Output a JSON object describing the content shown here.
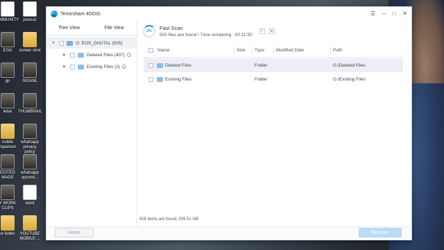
{
  "desktop": {
    "left_icons": [
      {
        "label": "UMMUNITY",
        "kind": "doc"
      },
      {
        "label": "EGG",
        "kind": "img"
      },
      {
        "label": "go",
        "kind": "img"
      },
      {
        "label": "letse",
        "kind": "img"
      },
      {
        "label": "nobile mparison",
        "kind": "folder"
      },
      {
        "label": "EDITED MAGE",
        "kind": "img"
      },
      {
        "label": "Y WORK CLIPS",
        "kind": "img"
      },
      {
        "label": "w folder",
        "kind": "folder"
      }
    ],
    "right_icons": [
      {
        "label": "posnuz",
        "kind": "doc"
      },
      {
        "label": "screen shot",
        "kind": "folder"
      },
      {
        "label": "SIGANL",
        "kind": "img"
      },
      {
        "label": "THUMBNAIL",
        "kind": "img"
      },
      {
        "label": "whatsapp privacy policy",
        "kind": "img"
      },
      {
        "label": "whatsapp upcomi...",
        "kind": "img"
      },
      {
        "label": "word",
        "kind": "doc"
      },
      {
        "label": "YOUTUBE MOBILE ...",
        "kind": "folder"
      }
    ]
  },
  "app": {
    "title": "Tenorshare 4DDiG",
    "controls": [
      "☰",
      "–",
      "□",
      "✕"
    ]
  },
  "left_pane": {
    "tabs": [
      "Tree View",
      "File View"
    ],
    "root": {
      "label": "G: EOS_DIGITAL (505)"
    },
    "children": [
      {
        "label": "Deleted Files (407)"
      },
      {
        "label": "Existing Files (3)"
      }
    ]
  },
  "scan": {
    "progress_percent": 2,
    "progress_label": "2%",
    "title": "Fast Scan",
    "summary": "505 files are found /  Time remaining : 00:11:50"
  },
  "table": {
    "columns": [
      "Name",
      "Size",
      "Type",
      "Modified Date",
      "Path"
    ],
    "rows": [
      {
        "name": "Deleted Files",
        "size": "",
        "type": "Folder",
        "modified": "",
        "path": "G:\\Deleted Files"
      },
      {
        "name": "Existing Files",
        "size": "",
        "type": "Folder",
        "modified": "",
        "path": "G:\\Existing Files"
      }
    ]
  },
  "status": {
    "text": "505 items are found, 209.51 GB"
  },
  "footer": {
    "home_label": "Home",
    "recover_label": "Recover"
  }
}
